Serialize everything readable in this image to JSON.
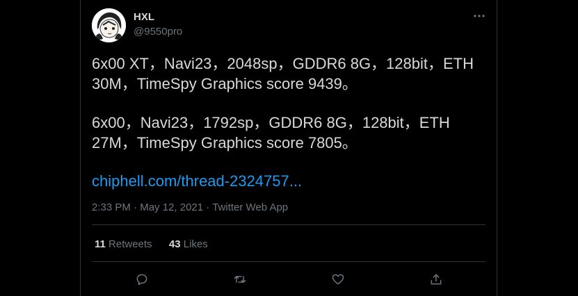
{
  "user": {
    "display_name": "HXL",
    "handle": "@9550pro",
    "avatar_icon": "anime-avatar-icon"
  },
  "tweet": {
    "lines_1": [
      "6x00 XT，Navi23，2048sp，GDDR6 8G，128bit，ETH",
      "30M，TimeSpy Graphics score 9439。"
    ],
    "lines_2": [
      "6x00，Navi23，1792sp，GDDR6 8G，128bit，ETH",
      "27M，TimeSpy Graphics score 7805。"
    ],
    "link": "chiphell.com/thread-2324757..."
  },
  "meta": {
    "time": "2:33 PM",
    "date": "May 12, 2021",
    "source": "Twitter Web App",
    "sep": "·"
  },
  "stats": {
    "retweets_count": "11",
    "retweets_label": "Retweets",
    "likes_count": "43",
    "likes_label": "Likes"
  },
  "actions": {
    "reply_icon": "reply-icon",
    "retweet_icon": "retweet-icon",
    "like_icon": "heart-icon",
    "share_icon": "share-icon"
  },
  "colors": {
    "background": "#000000",
    "text": "#d9d9d9",
    "muted": "#6e767d",
    "link": "#1d9bf0",
    "divider": "#2f3336"
  }
}
